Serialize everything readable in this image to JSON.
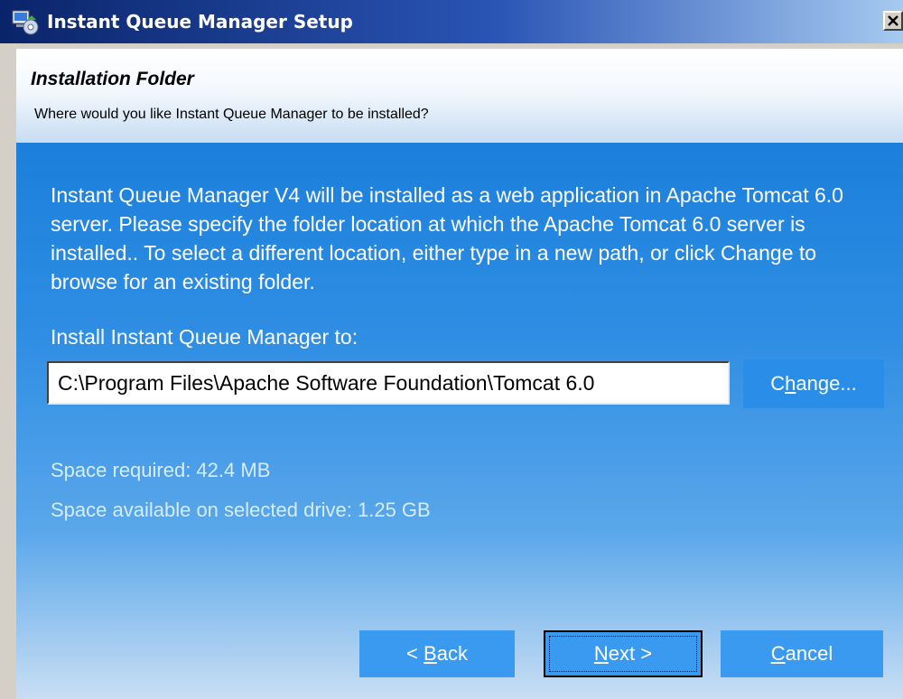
{
  "window": {
    "title": "Instant Queue Manager Setup"
  },
  "header": {
    "title": "Installation Folder",
    "subtitle": "Where would you like Instant Queue Manager to be installed?"
  },
  "main": {
    "description": "Instant Queue Manager V4 will be installed as a web application in Apache Tomcat 6.0 server. Please specify the folder location at which the Apache Tomcat 6.0 server is installed.. To select a different location, either type in a new path, or click Change to browse for an existing folder.",
    "install_label": "Install Instant Queue Manager to:",
    "install_path": "C:\\Program Files\\Apache Software Foundation\\Tomcat 6.0",
    "change_button": {
      "pre": "C",
      "accel": "h",
      "post": "ange..."
    },
    "space_required": "Space required: 42.4 MB",
    "space_available": "Space available on selected drive: 1.25 GB"
  },
  "footer": {
    "back_button": {
      "pre": "< ",
      "accel": "B",
      "post": "ack"
    },
    "next_button": {
      "pre": "",
      "accel": "N",
      "post": "ext >"
    },
    "cancel_button": {
      "pre": "",
      "accel": "C",
      "post": "ancel"
    }
  },
  "icons": {
    "app": "installer-app-icon",
    "close": "close-icon"
  },
  "colors": {
    "titlebar_start": "#0a246a",
    "titlebar_end": "#a6caf0",
    "panel_blue": "#1b7fdb",
    "button_blue": "#3a9af0",
    "dialog_gray": "#d4d0c8"
  }
}
